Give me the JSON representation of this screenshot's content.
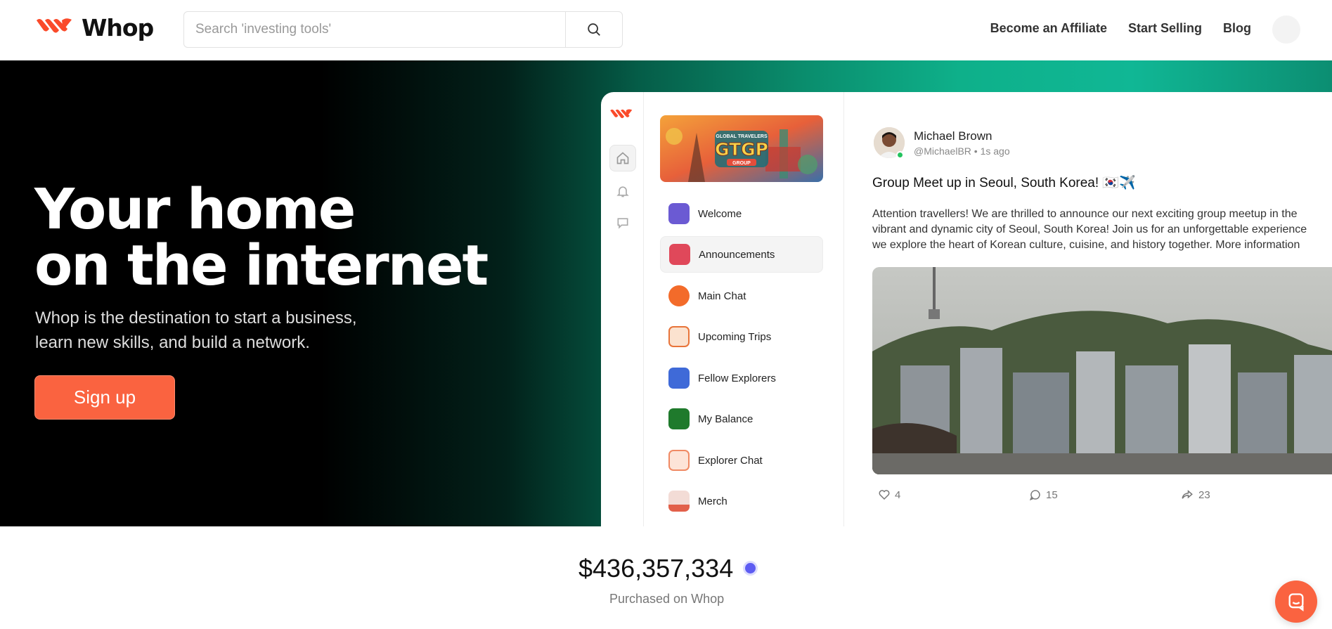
{
  "brand": {
    "name": "Whop",
    "accent": "#fa6340",
    "green": "#0eb08a"
  },
  "search": {
    "placeholder": "Search 'investing tools'",
    "icon": "search-icon"
  },
  "nav": {
    "items": [
      "Become an Affiliate",
      "Start Selling",
      "Blog"
    ]
  },
  "hero": {
    "title_line1": "Your home",
    "title_line2": "on the internet",
    "subtitle_line1": "Whop is the destination to start a business,",
    "subtitle_line2": "learn new skills, and build a network.",
    "cta": "Sign up"
  },
  "app": {
    "rail_icons": [
      "whop-logo-icon",
      "home-icon",
      "bell-icon",
      "chat-icon"
    ],
    "banner": {
      "line1": "GLOBAL TRAVELERS",
      "main": "GTGP",
      "line2": "GROUP"
    },
    "channels": [
      {
        "label": "Welcome",
        "icon": "graduation-cap-icon",
        "color": "#6b5ad3"
      },
      {
        "label": "Announcements",
        "icon": "megaphone-icon",
        "color": "#e0485a",
        "active": true
      },
      {
        "label": "Main Chat",
        "icon": "speech-bubble-icon",
        "color": "#f36b2a"
      },
      {
        "label": "Upcoming Trips",
        "icon": "star-icon",
        "color": "#e8743a"
      },
      {
        "label": "Fellow Explorers",
        "icon": "contacts-icon",
        "color": "#3f6ad8"
      },
      {
        "label": "My Balance",
        "icon": "money-icon",
        "color": "#26a63a"
      },
      {
        "label": "Explorer Chat",
        "icon": "notes-icon",
        "color": "#f08a64"
      },
      {
        "label": "Merch",
        "icon": "bag-icon",
        "color": "#e2604a"
      }
    ],
    "post": {
      "author": "Michael Brown",
      "handle": "@MichaelBR • 1s ago",
      "title": "Group Meet up in Seoul, South Korea! 🇰🇷✈️",
      "body_line1": "Attention travellers! We are thrilled to announce our next exciting group meetup in the",
      "body_line2": "vibrant and dynamic city of Seoul, South Korea! Join us for an unforgettable experience",
      "body_line3": "we explore the heart of Korean culture, cuisine, and history together. More information",
      "likes": "4",
      "comments": "15",
      "shares": "23"
    }
  },
  "stats": {
    "amount": "$436,357,334",
    "label": "Purchased on Whop"
  },
  "help": {
    "icon": "chat-support-icon"
  }
}
